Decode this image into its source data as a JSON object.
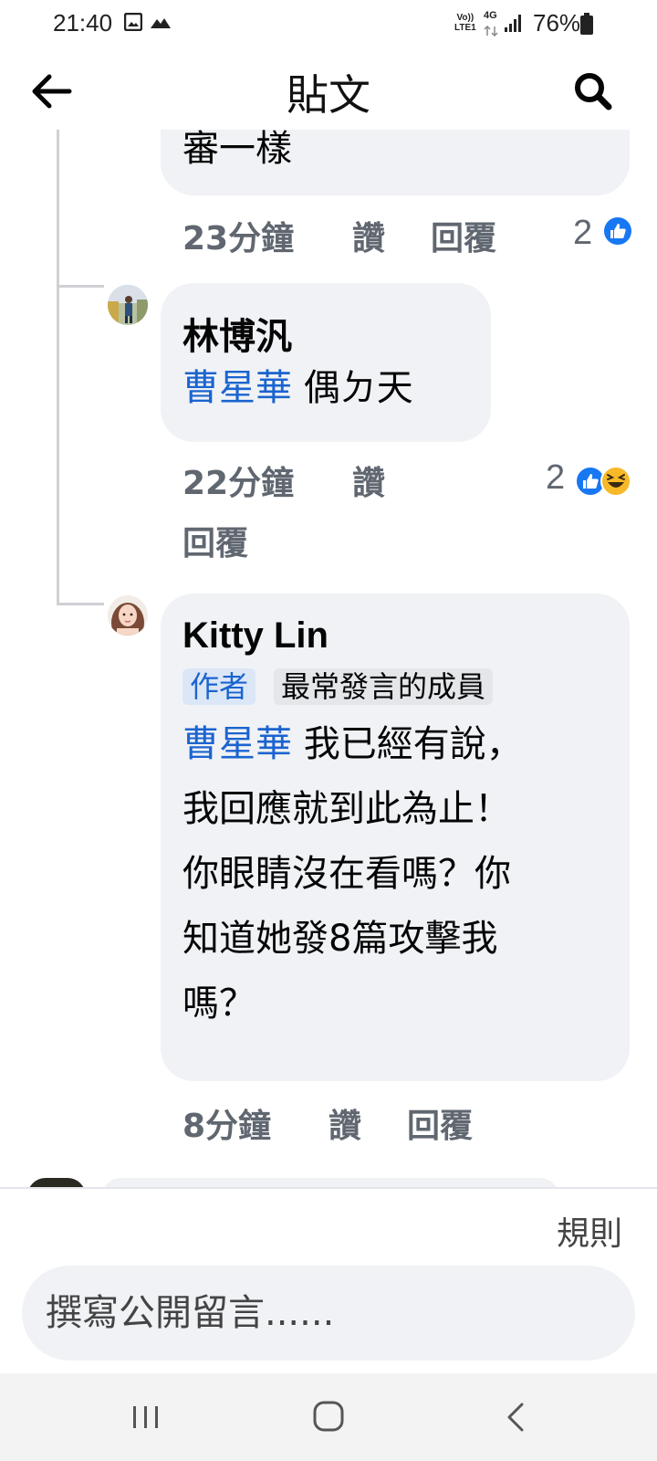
{
  "status_bar": {
    "time": "21:40",
    "network_top": "Vo))",
    "network_bottom": "LTE1",
    "network_type": "4G",
    "battery": "76%"
  },
  "header": {
    "title": "貼文"
  },
  "comments": [
    {
      "text_tail": "審一樣",
      "time": "23分鐘",
      "like_label": "讚",
      "reply_label": "回覆",
      "reaction_count": "2",
      "reactions": [
        "like"
      ]
    },
    {
      "author": "林博汎",
      "mention": "曹星華",
      "text": " 偶ㄉ天",
      "time": "22分鐘",
      "like_label": "讚",
      "reply_label": "回覆",
      "reaction_count": "2",
      "reactions": [
        "like",
        "haha"
      ]
    },
    {
      "author": "Kitty Lin",
      "badge_author": "作者",
      "badge_member": "最常發言的成員",
      "mention": "曹星華",
      "text_lines": [
        " 我已經有說，",
        "我回應就到此為止！",
        "你眼睛沒在看嗎？你",
        "知道她發8篇攻擊我",
        "嗎？"
      ],
      "time": "8分鐘",
      "like_label": "讚",
      "reply_label": "回覆"
    }
  ],
  "composer": {
    "rules_label": "規則",
    "placeholder": "撰寫公開留言......"
  },
  "colors": {
    "mention": "#1b64cf",
    "bubble": "#f0f2f5",
    "like_blue": "#1877f2",
    "haha_yellow": "#f7b928"
  }
}
